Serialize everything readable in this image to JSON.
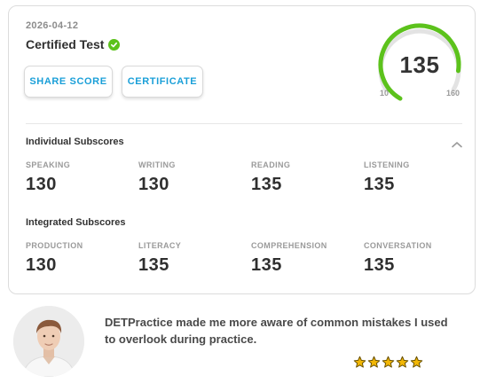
{
  "score_card": {
    "date": "2026-04-12",
    "title": "Certified Test",
    "share_label": "SHARE SCORE",
    "certificate_label": "CERTIFICATE",
    "gauge": {
      "score": "135",
      "min": "10",
      "max": "160",
      "fill_fraction": 0.83
    }
  },
  "individual": {
    "heading": "Individual Subscores",
    "items": [
      {
        "label": "SPEAKING",
        "value": "130"
      },
      {
        "label": "WRITING",
        "value": "130"
      },
      {
        "label": "READING",
        "value": "135"
      },
      {
        "label": "LISTENING",
        "value": "135"
      }
    ]
  },
  "integrated": {
    "heading": "Integrated Subscores",
    "items": [
      {
        "label": "PRODUCTION",
        "value": "130"
      },
      {
        "label": "LITERACY",
        "value": "135"
      },
      {
        "label": "COMPREHENSION",
        "value": "135"
      },
      {
        "label": "CONVERSATION",
        "value": "135"
      }
    ]
  },
  "testimonial": {
    "quote": "DETPractice made me more aware of common mistakes I used to overlook during practice.",
    "rating": 5
  },
  "colors": {
    "accent": "#1a9fd8",
    "success": "#5cc21c",
    "gauge_track": "#e3e3e3",
    "star": "#f2b705"
  },
  "icons": {
    "verified": "check-circle-icon",
    "collapse": "chevron-up-icon",
    "rating": "star-icon"
  }
}
